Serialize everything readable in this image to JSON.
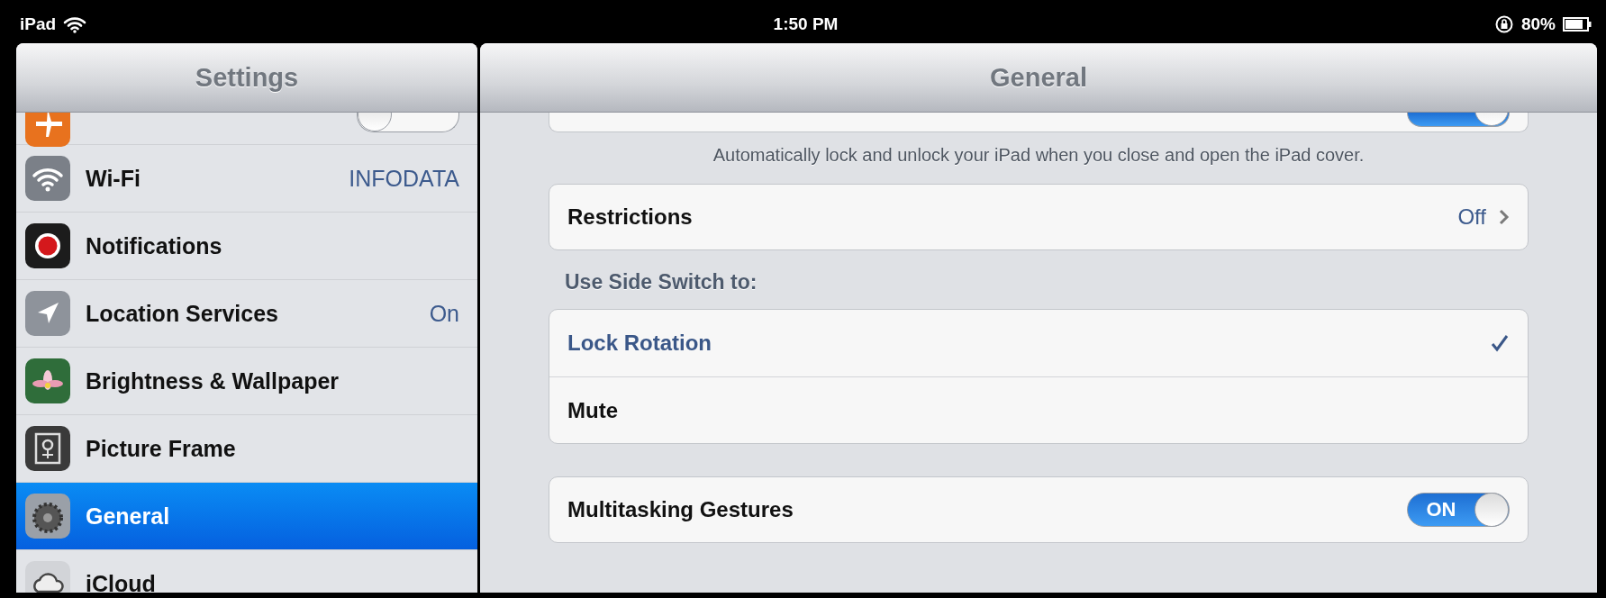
{
  "status_bar": {
    "device": "iPad",
    "time": "1:50 PM",
    "battery": "80%"
  },
  "sidebar": {
    "title": "Settings",
    "items": [
      {
        "kind": "toggle",
        "on": false,
        "selected": false
      },
      {
        "kind": "link",
        "label": "Wi-Fi",
        "value": "INFODATA",
        "selected": false
      },
      {
        "kind": "link",
        "label": "Notifications",
        "selected": false
      },
      {
        "kind": "link",
        "label": "Location Services",
        "value": "On",
        "selected": false
      },
      {
        "kind": "link",
        "label": "Brightness & Wallpaper",
        "selected": false
      },
      {
        "kind": "link",
        "label": "Picture Frame",
        "selected": false
      },
      {
        "kind": "link",
        "label": "General",
        "selected": true
      },
      {
        "kind": "link",
        "label": "iCloud",
        "selected": false
      }
    ]
  },
  "main": {
    "title": "General",
    "top_setting": {
      "on": true
    },
    "cover_note": "Automatically lock and unlock your iPad when you close and open the iPad cover.",
    "restrictions": {
      "label": "Restrictions",
      "value": "Off"
    },
    "side_switch": {
      "header": "Use Side Switch to:",
      "options": [
        {
          "label": "Lock Rotation",
          "selected": true
        },
        {
          "label": "Mute",
          "selected": false
        }
      ]
    },
    "multitasking": {
      "label": "Multitasking Gestures",
      "on": true,
      "switch_text": "ON"
    }
  }
}
